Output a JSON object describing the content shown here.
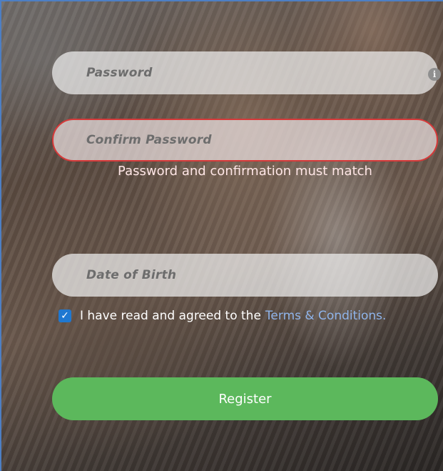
{
  "form": {
    "password": {
      "placeholder": "Password"
    },
    "confirm_password": {
      "placeholder": "Confirm Password",
      "error": "Password and confirmation must match"
    },
    "date_of_birth": {
      "placeholder": "Date of Birth"
    },
    "terms": {
      "checked": true,
      "text": "I have read and agreed to the",
      "link_text": "Terms & Conditions."
    },
    "register_label": "Register"
  },
  "colors": {
    "accent_green": "#5cb85c",
    "error_red": "#d63a3a",
    "link_blue": "#8fb4ea",
    "checkbox_blue": "#1f78d1"
  },
  "icons": {
    "password_hint": "info-icon",
    "checkbox_mark": "checkmark-icon"
  }
}
